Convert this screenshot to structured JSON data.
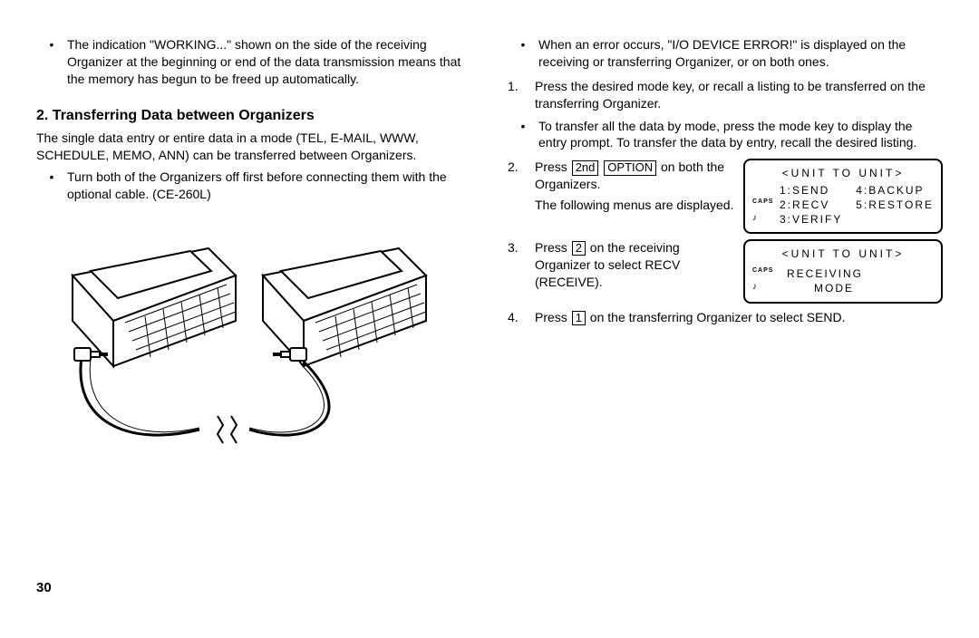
{
  "left": {
    "bullet_working": "The indication \"WORKING...\" shown on the side of the receiving Organizer at the beginning or end of the data transmission means that the memory has begun to be freed up automatically.",
    "section_number": "2.",
    "section_title": "Transferring Data between Organizers",
    "intro": "The single data entry or entire data in a mode (TEL, E-MAIL, WWW, SCHEDULE, MEMO, ANN) can be transferred between Organizers.",
    "bullet_cable": "Turn both of the Organizers off first before connecting them with the optional cable. (CE-260L)"
  },
  "right": {
    "bullet_error": "When an error occurs, \"I/O DEVICE ERROR!\" is displayed on the receiving or transferring Organizer, or on both ones.",
    "step1": "Press the desired mode key, or recall a listing to be transferred on the transferring Organizer.",
    "bullet_transfer_all": "To transfer all the data by mode, press the mode key to display the entry prompt. To transfer the data by entry, recall the desired listing.",
    "step2_pre": "Press ",
    "step2_key1": "2nd",
    "step2_key2": "OPTION",
    "step2_post": " on both the Organizers.",
    "step2_sub": "The following menus are displayed.",
    "step3_pre": "Press ",
    "step3_key": "2",
    "step3_post": " on the receiving Organizer to select RECV (RECEIVE).",
    "step4_pre": "Press ",
    "step4_key": "1",
    "step4_post": " on the transferring Organizer to select SEND.",
    "step_labels": {
      "s1": "1.",
      "s2": "2.",
      "s3": "3.",
      "s4": "4."
    }
  },
  "lcd1": {
    "title": "<UNIT TO UNIT>",
    "row1_left": "",
    "row1_a": "1:SEND",
    "row1_b": "4:BACKUP",
    "row2_left": "CAPS",
    "row2_a": "2:RECV",
    "row2_b": "5:RESTORE",
    "row3_left": "♪",
    "row3_a": "3:VERIFY",
    "row3_b": ""
  },
  "lcd2": {
    "title": "<UNIT TO UNIT>",
    "row1_left": "CAPS",
    "row1_text": "RECEIVING",
    "row2_left": "♪",
    "row2_text": "MODE"
  },
  "page_number": "30",
  "bullet": "•"
}
